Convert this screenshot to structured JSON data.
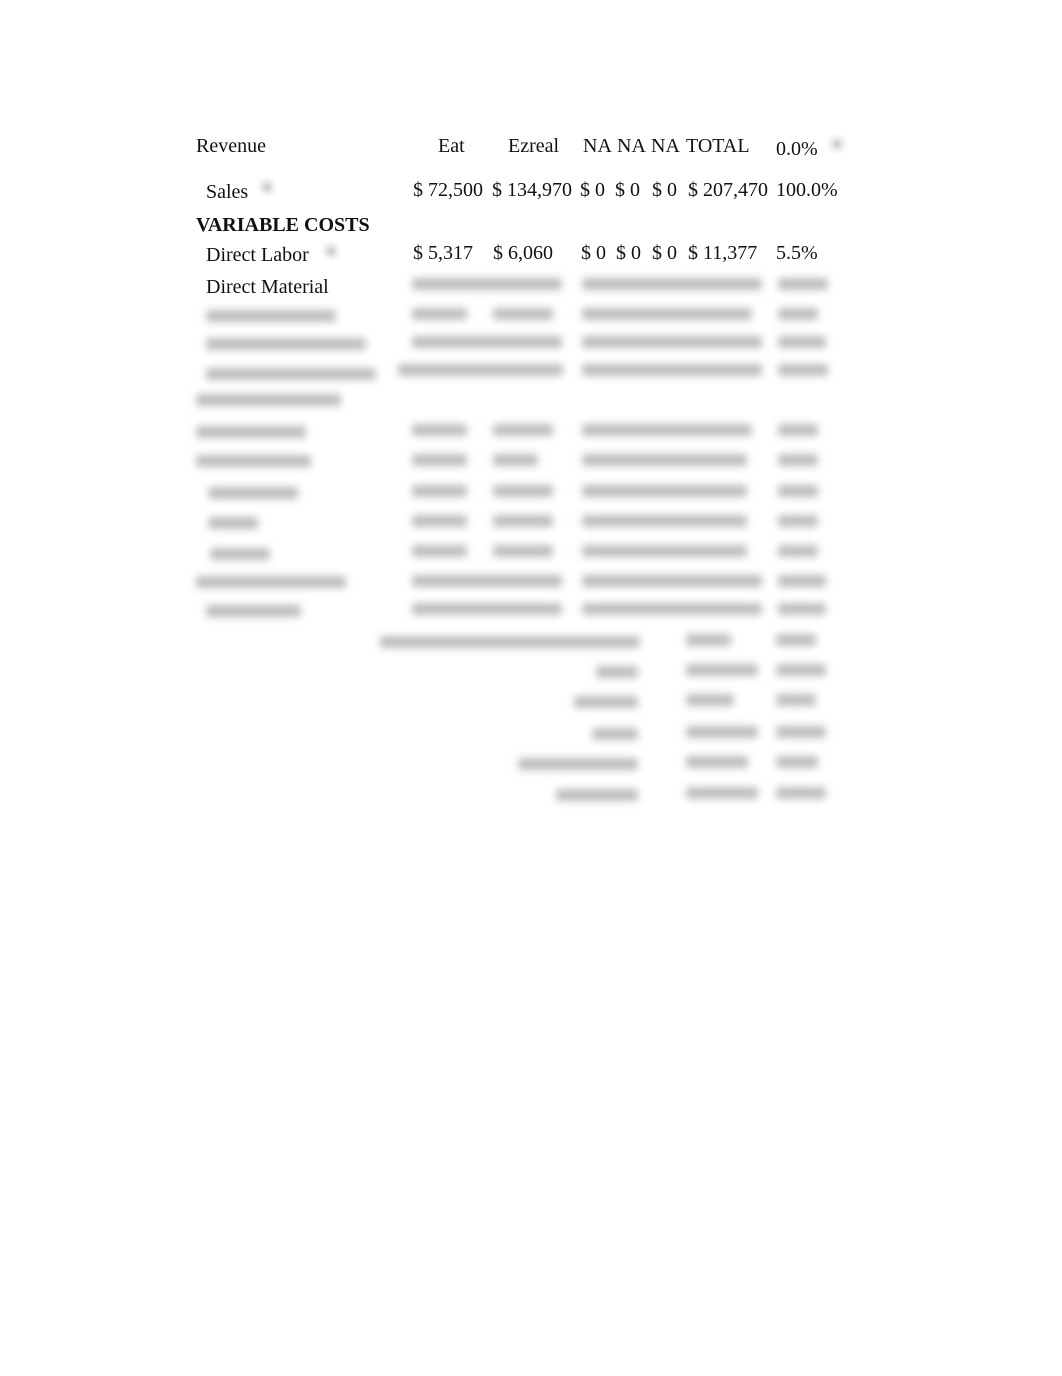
{
  "header": {
    "row_label": "Revenue",
    "columns": [
      "Eat",
      "Ezreal",
      "NA",
      "NA",
      "NA",
      "TOTAL"
    ],
    "pct": "0.0%"
  },
  "rows": [
    {
      "label": "Sales",
      "values": [
        "$ 72,500",
        "$ 134,970",
        "$ 0",
        "$ 0",
        "$ 0",
        "$ 207,470"
      ],
      "pct": "100.0%"
    },
    {
      "label": "VARIABLE COSTS",
      "section": true
    },
    {
      "label": "Direct Labor",
      "values": [
        "$ 5,317",
        "$ 6,060",
        "$ 0",
        "$ 0",
        "$ 0",
        "$ 11,377"
      ],
      "pct": "5.5%"
    },
    {
      "label": "Direct Material",
      "values_obscured": true
    }
  ],
  "obscured_notice": "Remaining rows blurred / not legible"
}
